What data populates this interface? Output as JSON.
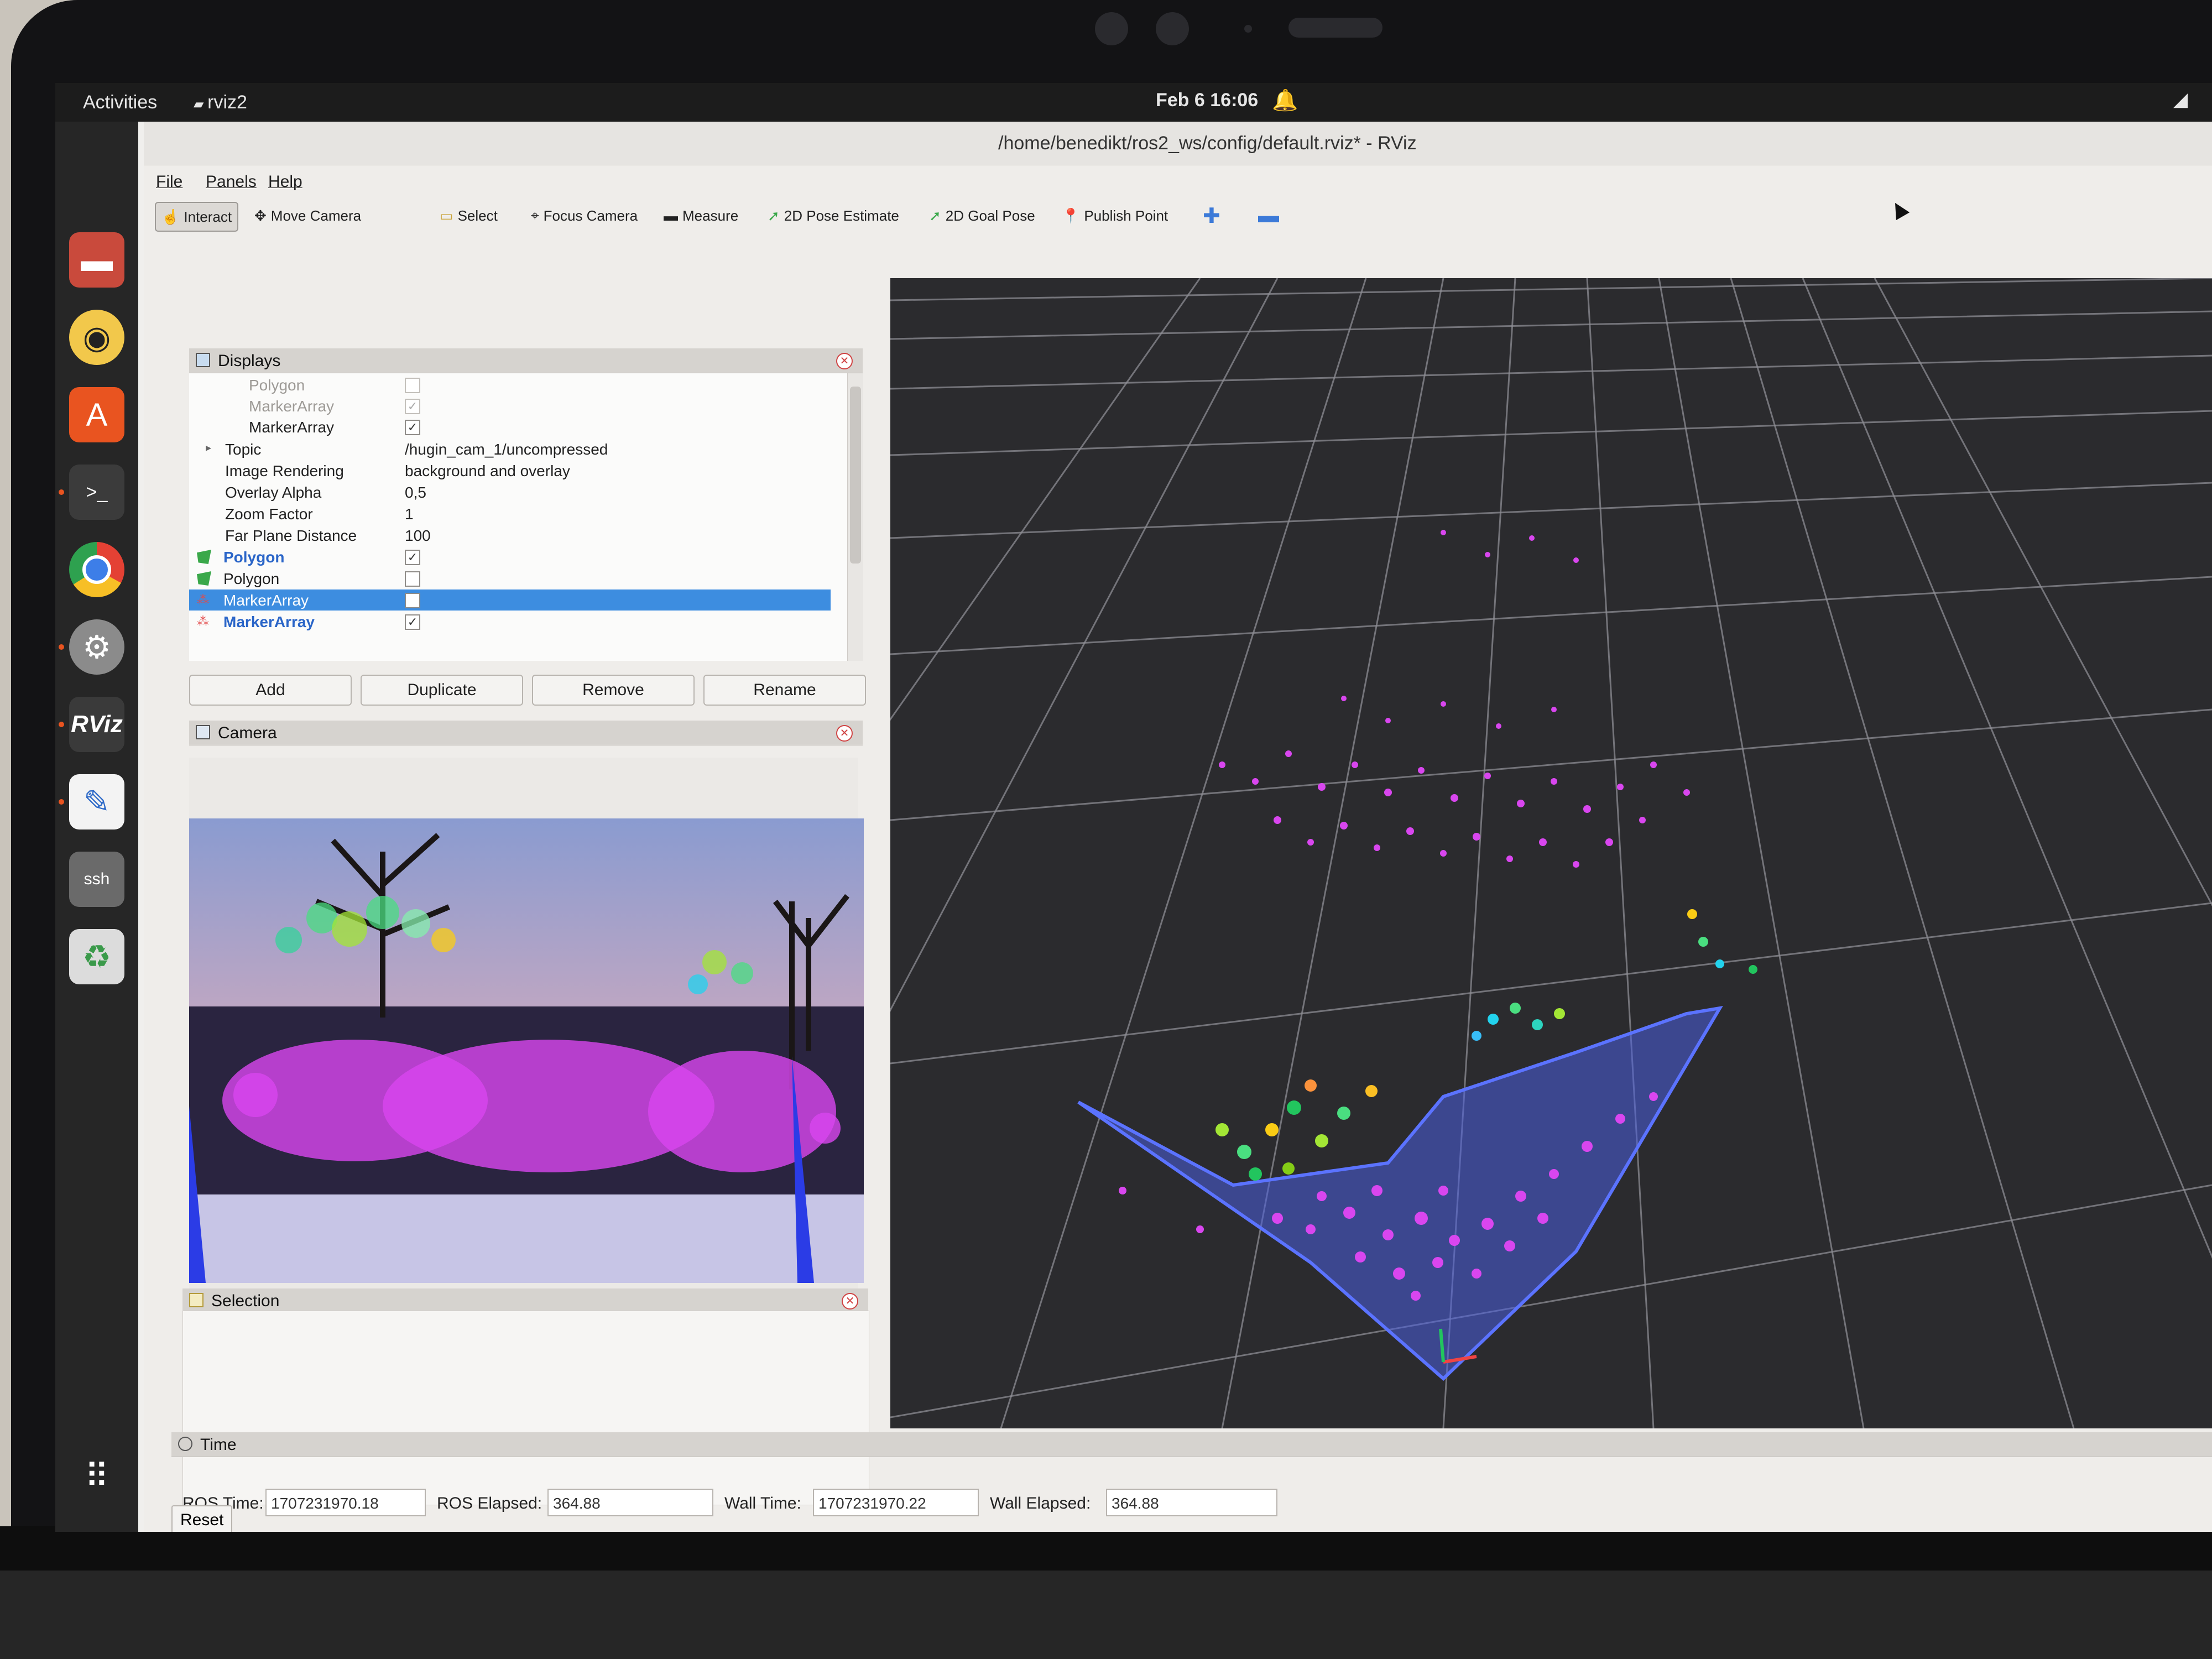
{
  "topbar": {
    "activities": "Activities",
    "app": "rviz2",
    "clock": "Feb 6  16:06"
  },
  "window": {
    "title": "/home/benedikt/ros2_ws/config/default.rviz* - RViz"
  },
  "menu": [
    "File",
    "Panels",
    "Help"
  ],
  "toolbar": {
    "interact": "Interact",
    "move_camera": "Move Camera",
    "select": "Select",
    "focus_camera": "Focus Camera",
    "measure": "Measure",
    "pose_estimate": "2D Pose Estimate",
    "goal_pose": "2D Goal Pose",
    "publish_point": "Publish Point"
  },
  "displays": {
    "title": "Displays",
    "rows": [
      {
        "name": "Polygon",
        "checked": false,
        "style": "dim"
      },
      {
        "name": "MarkerArray",
        "checked": true,
        "style": "dim"
      },
      {
        "name": "MarkerArray",
        "checked": true,
        "style": "normal"
      },
      {
        "name": "Topic",
        "value": "/hugin_cam_1/uncompressed"
      },
      {
        "name": "Image Rendering",
        "value": "background and overlay"
      },
      {
        "name": "Overlay Alpha",
        "value": "0,5"
      },
      {
        "name": "Zoom Factor",
        "value": "1"
      },
      {
        "name": "Far Plane Distance",
        "value": "100"
      },
      {
        "name": "Polygon",
        "checked": true,
        "style": "blue"
      },
      {
        "name": "Polygon",
        "checked": false,
        "style": "normal"
      },
      {
        "name": "MarkerArray",
        "checked": false,
        "style": "selected"
      },
      {
        "name": "MarkerArray",
        "checked": true,
        "style": "blue"
      }
    ],
    "buttons": {
      "add": "Add",
      "duplicate": "Duplicate",
      "remove": "Remove",
      "rename": "Rename"
    }
  },
  "camera": {
    "title": "Camera"
  },
  "selection": {
    "title": "Selection"
  },
  "time": {
    "title": "Time",
    "ros_time_label": "ROS Time:",
    "ros_time": "1707231970.18",
    "ros_elapsed_label": "ROS Elapsed:",
    "ros_elapsed": "364.88",
    "wall_time_label": "Wall Time:",
    "wall_time": "1707231970.22",
    "wall_elapsed_label": "Wall Elapsed:",
    "wall_elapsed": "364.88",
    "reset": "Reset"
  },
  "colors": {
    "accent": "#3d8de0",
    "marker_pink": "#d946ef",
    "polygon_blue": "#4a5fe0",
    "grid": "#9a9aa0"
  },
  "icons": {
    "dock": [
      "files-icon",
      "rhythmbox-icon",
      "software-icon",
      "terminal-icon",
      "chrome-icon",
      "settings-icon",
      "rviz-icon",
      "text-editor-icon",
      "ssh-icon",
      "trash-icon",
      "app-grid-icon"
    ]
  }
}
